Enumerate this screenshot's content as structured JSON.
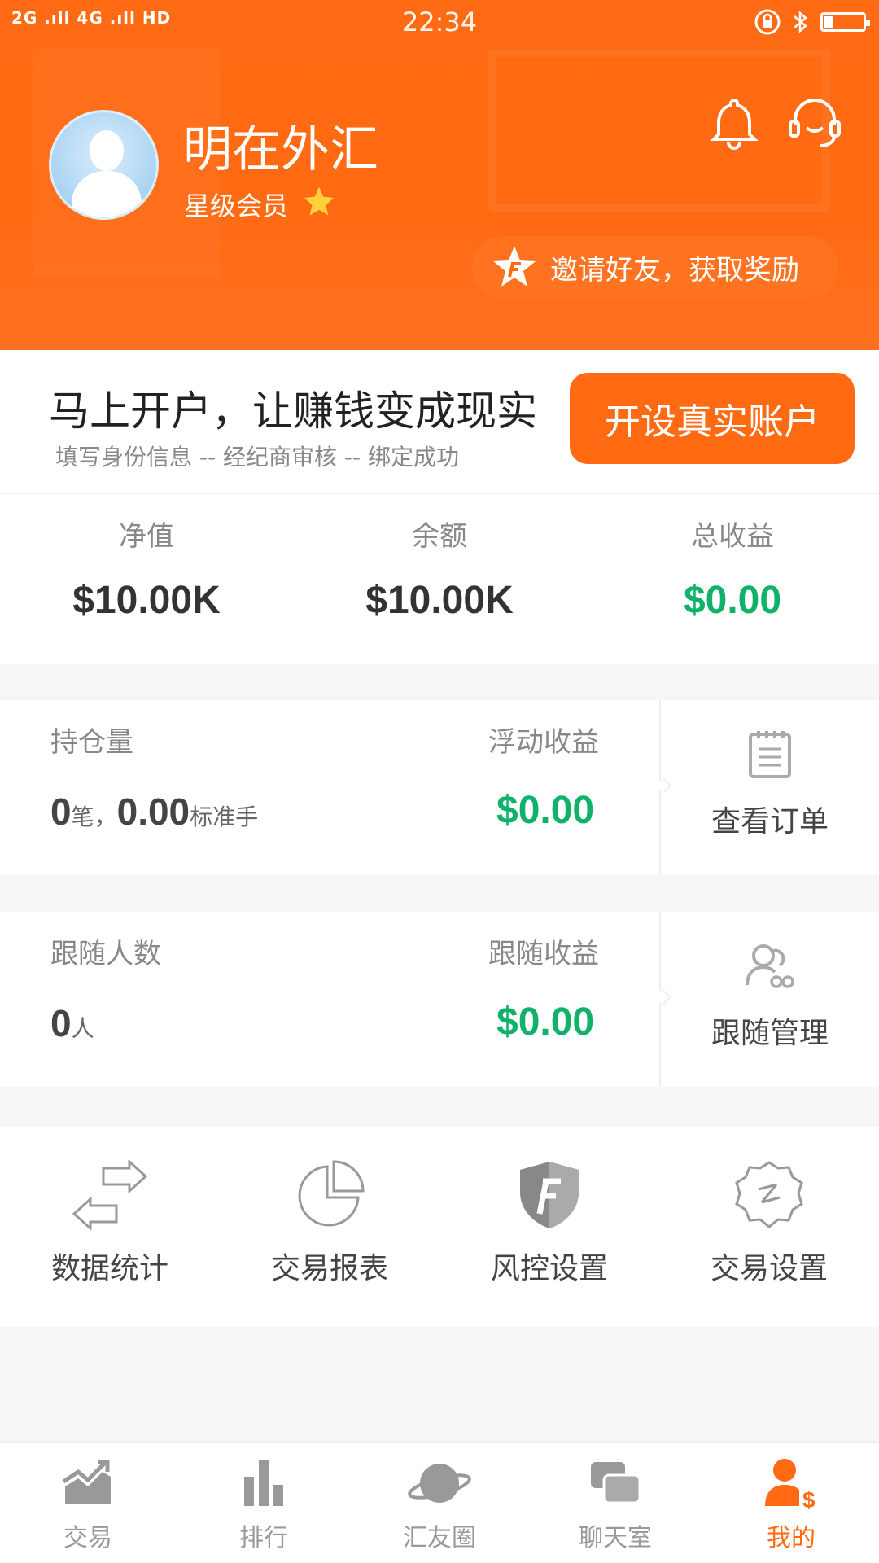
{
  "status_bar": {
    "left": "2G .ıll 4G .ıll HD",
    "time": "22:34"
  },
  "profile": {
    "name": "明在外汇",
    "member_level": "星级会员",
    "invite_text": "邀请好友，获取奖励"
  },
  "open_account": {
    "title": "马上开户，让赚钱变成现实",
    "subtitle": "填写身份信息 -- 经纪商审核 -- 绑定成功",
    "button": "开设真实账户"
  },
  "stats": [
    {
      "label": "净值",
      "value": "$10.00K",
      "color": "#444444"
    },
    {
      "label": "余额",
      "value": "$10.00K",
      "color": "#444444"
    },
    {
      "label": "总收益",
      "value": "$0.00",
      "color": "#10b26a"
    }
  ],
  "positions": {
    "label": "持仓量",
    "count": "0",
    "count_unit": "笔，",
    "lots": "0.00",
    "lots_unit": "标准手",
    "float_label": "浮动收益",
    "float_value": "$0.00",
    "action": "查看订单"
  },
  "followers": {
    "label": "跟随人数",
    "count": "0",
    "count_unit": "人",
    "profit_label": "跟随收益",
    "profit_value": "$0.00",
    "action": "跟随管理"
  },
  "tools": [
    {
      "label": "数据统计",
      "icon": "data-stats-icon"
    },
    {
      "label": "交易报表",
      "icon": "pie-chart-icon"
    },
    {
      "label": "风控设置",
      "icon": "shield-icon"
    },
    {
      "label": "交易设置",
      "icon": "gear-icon"
    }
  ],
  "nav": [
    {
      "label": "交易",
      "icon": "trade-chart-icon",
      "active": false
    },
    {
      "label": "排行",
      "icon": "ranking-icon",
      "active": false
    },
    {
      "label": "汇友圈",
      "icon": "planet-icon",
      "active": false
    },
    {
      "label": "聊天室",
      "icon": "chat-icon",
      "active": false
    },
    {
      "label": "我的",
      "icon": "profile-dollar-icon",
      "active": true
    }
  ],
  "colors": {
    "brand": "#ff6a13",
    "profit": "#10b26a"
  }
}
